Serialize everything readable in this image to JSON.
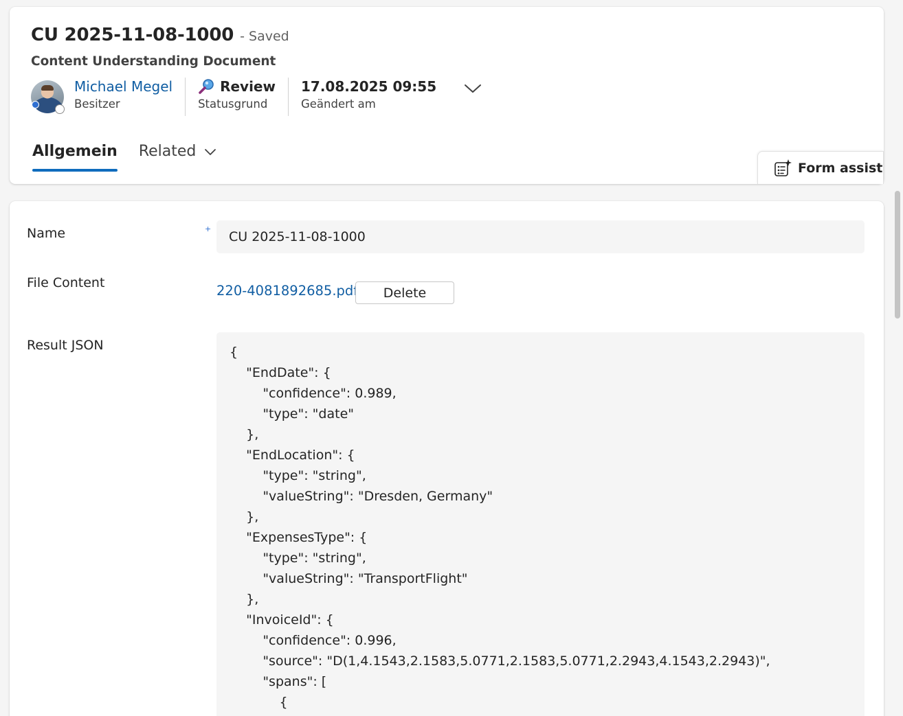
{
  "header": {
    "title": "CU 2025-11-08-1000",
    "saved_status": "- Saved",
    "entity_name": "Content Understanding Document",
    "owner": {
      "name": "Michael Megel",
      "caption": "Besitzer"
    },
    "status": {
      "value": "Review",
      "caption": "Statusgrund"
    },
    "modified": {
      "value": "17.08.2025 09:55",
      "caption": "Geändert am"
    }
  },
  "tabs": [
    {
      "label": "Allgemein",
      "active": true
    },
    {
      "label": "Related",
      "active": false
    }
  ],
  "form_assist": {
    "label": "Form assist"
  },
  "form": {
    "name": {
      "label": "Name",
      "required_mark": "+",
      "value": "CU 2025-11-08-1000"
    },
    "file_content": {
      "label": "File Content",
      "file_name": "220-4081892685.pdf",
      "delete_label": "Delete"
    },
    "result_json": {
      "label": "Result JSON",
      "lines": [
        "{",
        "    \"EndDate\": {",
        "        \"confidence\": 0.989,",
        "        \"type\": \"date\"",
        "    },",
        "    \"EndLocation\": {",
        "        \"type\": \"string\",",
        "        \"valueString\": \"Dresden, Germany\"",
        "    },",
        "    \"ExpensesType\": {",
        "        \"type\": \"string\",",
        "        \"valueString\": \"TransportFlight\"",
        "    },",
        "    \"InvoiceId\": {",
        "        \"confidence\": 0.996,",
        "        \"source\": \"D(1,4.1543,2.1583,5.0771,2.1583,5.0771,2.2943,4.1543,2.2943)\",",
        "        \"spans\": [",
        "            {"
      ]
    }
  },
  "colors": {
    "accent": "#0f6cbd",
    "link": "#115ea3",
    "page_background": "#f5f5f5"
  }
}
